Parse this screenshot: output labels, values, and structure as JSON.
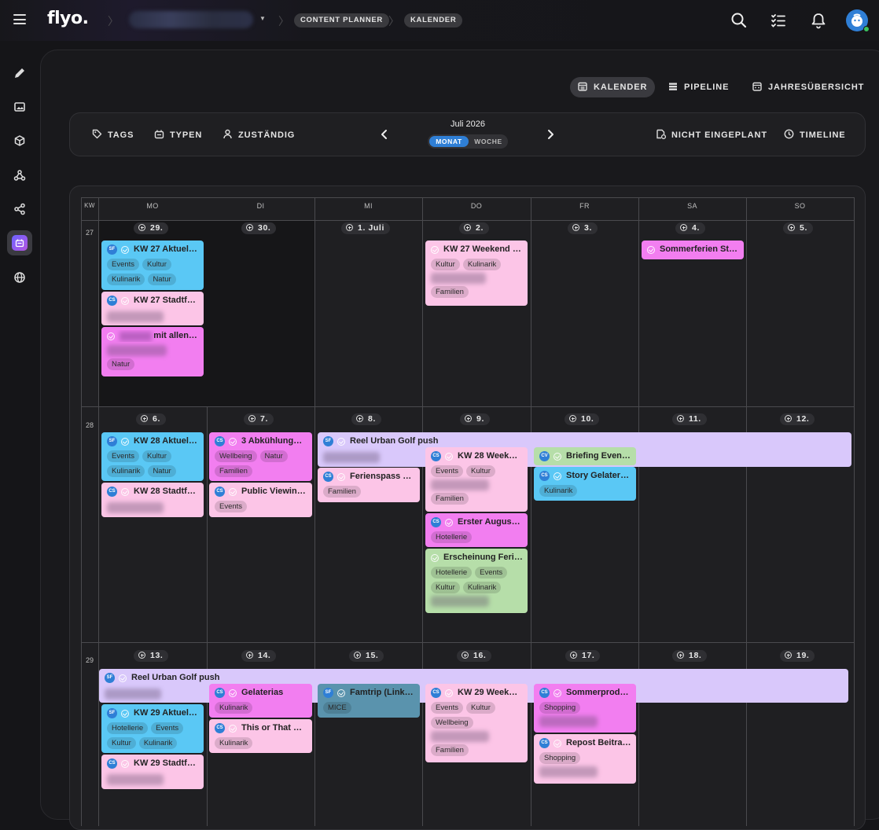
{
  "app": {
    "logo": "flyo.",
    "breadcrumb": [
      "CONTENT PLANNER",
      "KALENDER"
    ]
  },
  "view_tabs": [
    {
      "label": "KALENDER",
      "active": true
    },
    {
      "label": "PIPELINE"
    },
    {
      "label": "JAHRESÜBERSICHT"
    }
  ],
  "toolbar": {
    "tags": "TAGS",
    "typen": "TYPEN",
    "zustaendig": "ZUSTÄNDIG",
    "month": "Juli 2026",
    "monat": "MONAT",
    "woche": "WOCHE",
    "nicht_eingeplant": "NICHT EINGEPLANT",
    "timeline": "TIMELINE"
  },
  "calendar": {
    "kw_label": "KW",
    "weekdays": [
      "MO",
      "DI",
      "MI",
      "DO",
      "FR",
      "SA",
      "SO"
    ],
    "weeks": [
      {
        "kw": "27",
        "days": [
          "29.",
          "30.",
          "1. Juli",
          "2.",
          "3.",
          "4.",
          "5."
        ]
      },
      {
        "kw": "28",
        "days": [
          "6.",
          "7.",
          "8.",
          "9.",
          "10.",
          "11.",
          "12."
        ]
      },
      {
        "kw": "29",
        "days": [
          "13.",
          "14.",
          "15.",
          "16.",
          "17.",
          "18.",
          "19."
        ]
      }
    ]
  },
  "cards": {
    "c1": {
      "av": "SF",
      "title": "KW 27 Aktuel…",
      "tags": [
        "Events",
        "Kultur",
        "Kulinarik",
        "Natur"
      ]
    },
    "c2": {
      "av": "CS",
      "title": "KW 27 Stadtf…"
    },
    "c3": {
      "title": "mit allen …",
      "tags": [
        "Natur"
      ]
    },
    "c4": {
      "title": "KW 27 Weekend …",
      "tags": [
        "Kultur",
        "Kulinarik"
      ],
      "tags2": [
        "Familien"
      ]
    },
    "c5": {
      "title": "Sommerferien St…"
    },
    "c6": {
      "av": "SF",
      "title": "KW 28 Aktuel…",
      "tags": [
        "Events",
        "Kultur",
        "Kulinarik",
        "Natur"
      ]
    },
    "c7": {
      "av": "CS",
      "title": "KW 28 Stadtf…"
    },
    "c8": {
      "av": "CS",
      "title": "3 Abkühlung…",
      "tags": [
        "Wellbeing",
        "Natur",
        "Familien"
      ]
    },
    "c9": {
      "av": "CS",
      "title": "Public Viewin…",
      "tags": [
        "Events"
      ]
    },
    "c10": {
      "av": "SF",
      "title": "Reel Urban Golf push"
    },
    "c11": {
      "av": "CS",
      "title": "Ferienspass …",
      "tags": [
        "Familien"
      ]
    },
    "c12": {
      "av": "CS",
      "title": "KW 28 Week…",
      "tags": [
        "Events",
        "Kultur"
      ],
      "tags2": [
        "Familien"
      ]
    },
    "c13": {
      "av": "CV",
      "title": "Briefing Even…"
    },
    "c14": {
      "av": "CS",
      "title": "Story Gelateri…",
      "tags": [
        "Kulinarik"
      ]
    },
    "c15": {
      "av": "CS",
      "title": "Erster August…",
      "tags": [
        "Hotellerie"
      ]
    },
    "c16": {
      "title": "Erscheinung Feri…",
      "tags": [
        "Hotellerie",
        "Events",
        "Kultur",
        "Kulinarik"
      ]
    },
    "c17": {
      "av": "SF",
      "title": "Reel Urban Golf push"
    },
    "c18": {
      "av": "CS",
      "title": "Gelaterias",
      "tags": [
        "Kulinarik"
      ]
    },
    "c19": {
      "av": "SF",
      "title": "Famtrip (Link…",
      "tags": [
        "MICE"
      ]
    },
    "c20": {
      "av": "CS",
      "title": "KW 29 Week…",
      "tags": [
        "Events",
        "Kultur",
        "Wellbeing"
      ],
      "tags2": [
        "Familien"
      ]
    },
    "c21": {
      "av": "CS",
      "title": "Sommerprod…",
      "tags": [
        "Shopping"
      ]
    },
    "c22": {
      "av": "SF",
      "title": "KW 29 Aktuel…",
      "tags": [
        "Hotellerie",
        "Events",
        "Kultur",
        "Kulinarik"
      ]
    },
    "c23": {
      "av": "CS",
      "title": "This or That …",
      "tags": [
        "Kulinarik"
      ]
    },
    "c24": {
      "av": "CS",
      "title": "Repost Beitra…",
      "tags": [
        "Shopping"
      ]
    },
    "c25": {
      "av": "CS",
      "title": "KW 29 Stadtf…"
    }
  }
}
